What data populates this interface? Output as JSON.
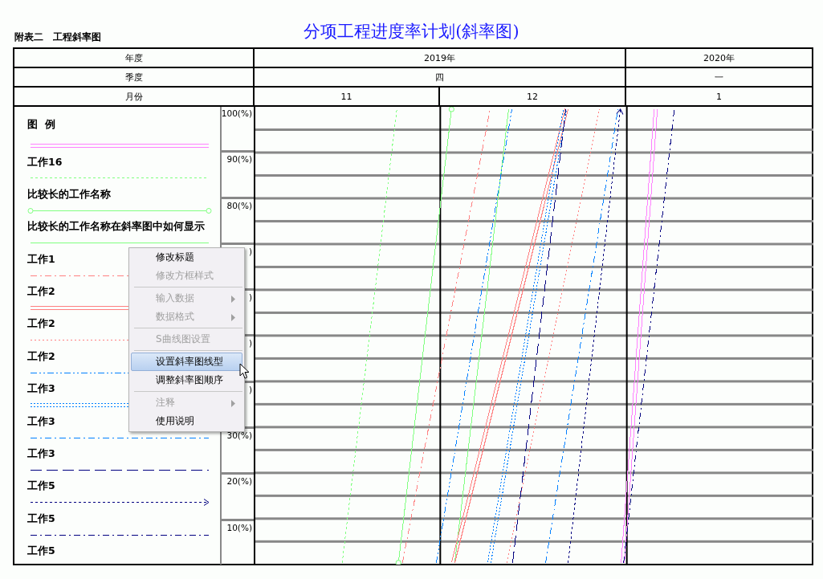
{
  "title": "分项工程进度率计划(斜率图)",
  "subtitle": "附表二　工程斜率图",
  "header": {
    "rows": [
      {
        "label": "年度",
        "cells": [
          {
            "text": "2019年"
          },
          {
            "text": "2020年"
          }
        ]
      },
      {
        "label": "季度",
        "cells": [
          {
            "text": "四"
          },
          {
            "text": "一"
          }
        ]
      },
      {
        "label": "月份",
        "cells": [
          {
            "text": "11"
          },
          {
            "text": "12"
          },
          {
            "text": "1"
          }
        ]
      }
    ]
  },
  "legend": {
    "heading": "图  例",
    "items": [
      {
        "name": "工作16",
        "color": "#ff80ff",
        "kind": "double"
      },
      {
        "name": "比较长的工作名称",
        "color": "#80ff80",
        "kind": "dashed"
      },
      {
        "name": "比较长的工作名称在斜率图中如何显示",
        "color": "#80ff80",
        "kind": "circles"
      },
      {
        "name": "工作1",
        "color": "#80ff80",
        "kind": "solid"
      },
      {
        "name": "工作2",
        "color": "#ff8080",
        "kind": "dashdot"
      },
      {
        "name": "工作2",
        "color": "#ff8080",
        "kind": "double"
      },
      {
        "name": "工作2",
        "color": "#ff8080",
        "kind": "dotted"
      },
      {
        "name": "工作3",
        "color": "#0080ff",
        "kind": "dashdotdot"
      },
      {
        "name": "工作3",
        "color": "#0080ff",
        "kind": "doubledotted"
      },
      {
        "name": "工作3",
        "color": "#0080ff",
        "kind": "dashdot"
      },
      {
        "name": "工作5",
        "color": "#000080",
        "kind": "longdash"
      },
      {
        "name": "工作5",
        "color": "#000080",
        "kind": "arrow"
      },
      {
        "name": "工作5",
        "color": "#000080",
        "kind": "dashdot"
      }
    ]
  },
  "y_axis": [
    "100(%)",
    "90(%)",
    "80(%)",
    ")",
    ")",
    ")",
    ")",
    "30(%)",
    "20(%)",
    "10(%)"
  ],
  "context_menu": [
    {
      "kind": "item",
      "label": "修改标题",
      "disabled": false,
      "selected": false,
      "submenu": false
    },
    {
      "kind": "item",
      "label": "修改方框样式",
      "disabled": true,
      "selected": false,
      "submenu": false
    },
    {
      "kind": "separator"
    },
    {
      "kind": "item",
      "label": "输入数据",
      "disabled": true,
      "selected": false,
      "submenu": true
    },
    {
      "kind": "item",
      "label": "数据格式",
      "disabled": true,
      "selected": false,
      "submenu": true
    },
    {
      "kind": "separator"
    },
    {
      "kind": "item",
      "label": "S曲线图设置",
      "disabled": true,
      "selected": false,
      "submenu": false
    },
    {
      "kind": "separator"
    },
    {
      "kind": "item",
      "label": "设置斜率图线型",
      "disabled": false,
      "selected": true,
      "submenu": false
    },
    {
      "kind": "item",
      "label": "调整斜率图顺序",
      "disabled": false,
      "selected": false,
      "submenu": false
    },
    {
      "kind": "separator"
    },
    {
      "kind": "item",
      "label": "注释",
      "disabled": true,
      "selected": false,
      "submenu": true
    },
    {
      "kind": "item",
      "label": "使用说明",
      "disabled": false,
      "selected": false,
      "submenu": false
    }
  ]
}
